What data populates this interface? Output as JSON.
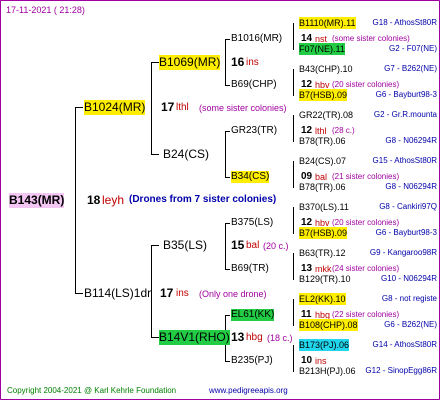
{
  "header": {
    "date": "17-11-2021 ( 21:28)"
  },
  "footer": {
    "copyright": "Copyright 2004-2021 @ Karl Kehrle Foundation",
    "site": "www.pedigreeapis.org"
  },
  "colors": {
    "border": "#a000a0",
    "highlight_yellow": "#ffee00",
    "highlight_green": "#22cc44",
    "highlight_cyan": "#22d6ee",
    "root_bg": "#f3c6f3"
  },
  "gen0": {
    "name": "B143(MR)",
    "num": "18",
    "code": "leyh",
    "note": "(Drones from 7 sister colonies)"
  },
  "gen1": [
    {
      "name": "B1024(MR)",
      "num": "17",
      "code": "lthl",
      "note": "(some sister colonies)"
    },
    {
      "name": "B114(LS)1dr",
      "num": "17",
      "code": "ins",
      "note": "(Only one drone)"
    }
  ],
  "gen2": [
    {
      "name": "B1069(MR)",
      "num": "16",
      "code": "ins"
    },
    {
      "name": "B24(CS)"
    },
    {
      "name": "B35(LS)",
      "num": "15",
      "code": "bal",
      "note": "(20 c.)"
    },
    {
      "name": "B14V1(RHO)",
      "num": "13",
      "code": "hbg",
      "note": "(18 c.)"
    }
  ],
  "gen3": [
    {
      "name": "B1016(MR)",
      "num": "14",
      "code": "nst",
      "note": "(some sister colonies)"
    },
    {
      "name": "B69(CHP)",
      "num": "12",
      "code": "hbv",
      "note": "(20 sister colonies)"
    },
    {
      "name": "GR23(TR)",
      "num": "12",
      "code": "lthl",
      "note": "(28 c.)"
    },
    {
      "name": "B34(CS)",
      "num": "09",
      "code": "bal",
      "note": "(21 sister colonies)"
    },
    {
      "name": "B375(LS)",
      "num": "12",
      "code": "hbv",
      "note": "(20 sister colonies)"
    },
    {
      "name": "B69(TR)",
      "num": "13",
      "code": "mkk",
      "note": "(24 sister colonies)"
    },
    {
      "name": "EL61(KK)",
      "num": "11",
      "code": "hbg",
      "note": "(22 sister colonies)"
    },
    {
      "name": "B235(PJ)",
      "num": "10",
      "code": "ins",
      "note": ""
    }
  ],
  "gen4": [
    {
      "name": "B1110(MR).11",
      "origin": "G18 - AthosSt80R"
    },
    {
      "name": "F07(NE).11",
      "origin": "G2 - F07(NE)"
    },
    {
      "name": "B43(CHP).10",
      "origin": "G7 - B262(NE)"
    },
    {
      "name": "B7(HSB).09",
      "origin": "G6 - Bayburt98-3"
    },
    {
      "name": "GR22(TR).08",
      "origin": "G2 - Gr.R.mounta"
    },
    {
      "name": "B78(TR).06",
      "origin": "G8 - N06294R"
    },
    {
      "name": "B24(CS).07",
      "origin": "G15 - AthosSt80R"
    },
    {
      "name": "B78(TR).06",
      "origin": "G8 - N06294R"
    },
    {
      "name": "B370(LS).11",
      "origin": "G8 - Cankiri97Q"
    },
    {
      "name": "B7(HSB).09",
      "origin": "G6 - Bayburt98-3"
    },
    {
      "name": "B63(TR).12",
      "origin": "G9 - Kangaroo98R"
    },
    {
      "name": "B129(TR).10",
      "origin": "G10 - N06294R"
    },
    {
      "name": "EL2(KK).10",
      "origin": "G8 - not registe"
    },
    {
      "name": "B108(CHP).08",
      "origin": "G6 - B262(NE)"
    },
    {
      "name": "B173(PJ).06",
      "origin": "G14 - AthosSt80R"
    },
    {
      "name": "B213H(PJ).06",
      "origin": "G12 - SinopEgg86R"
    }
  ]
}
